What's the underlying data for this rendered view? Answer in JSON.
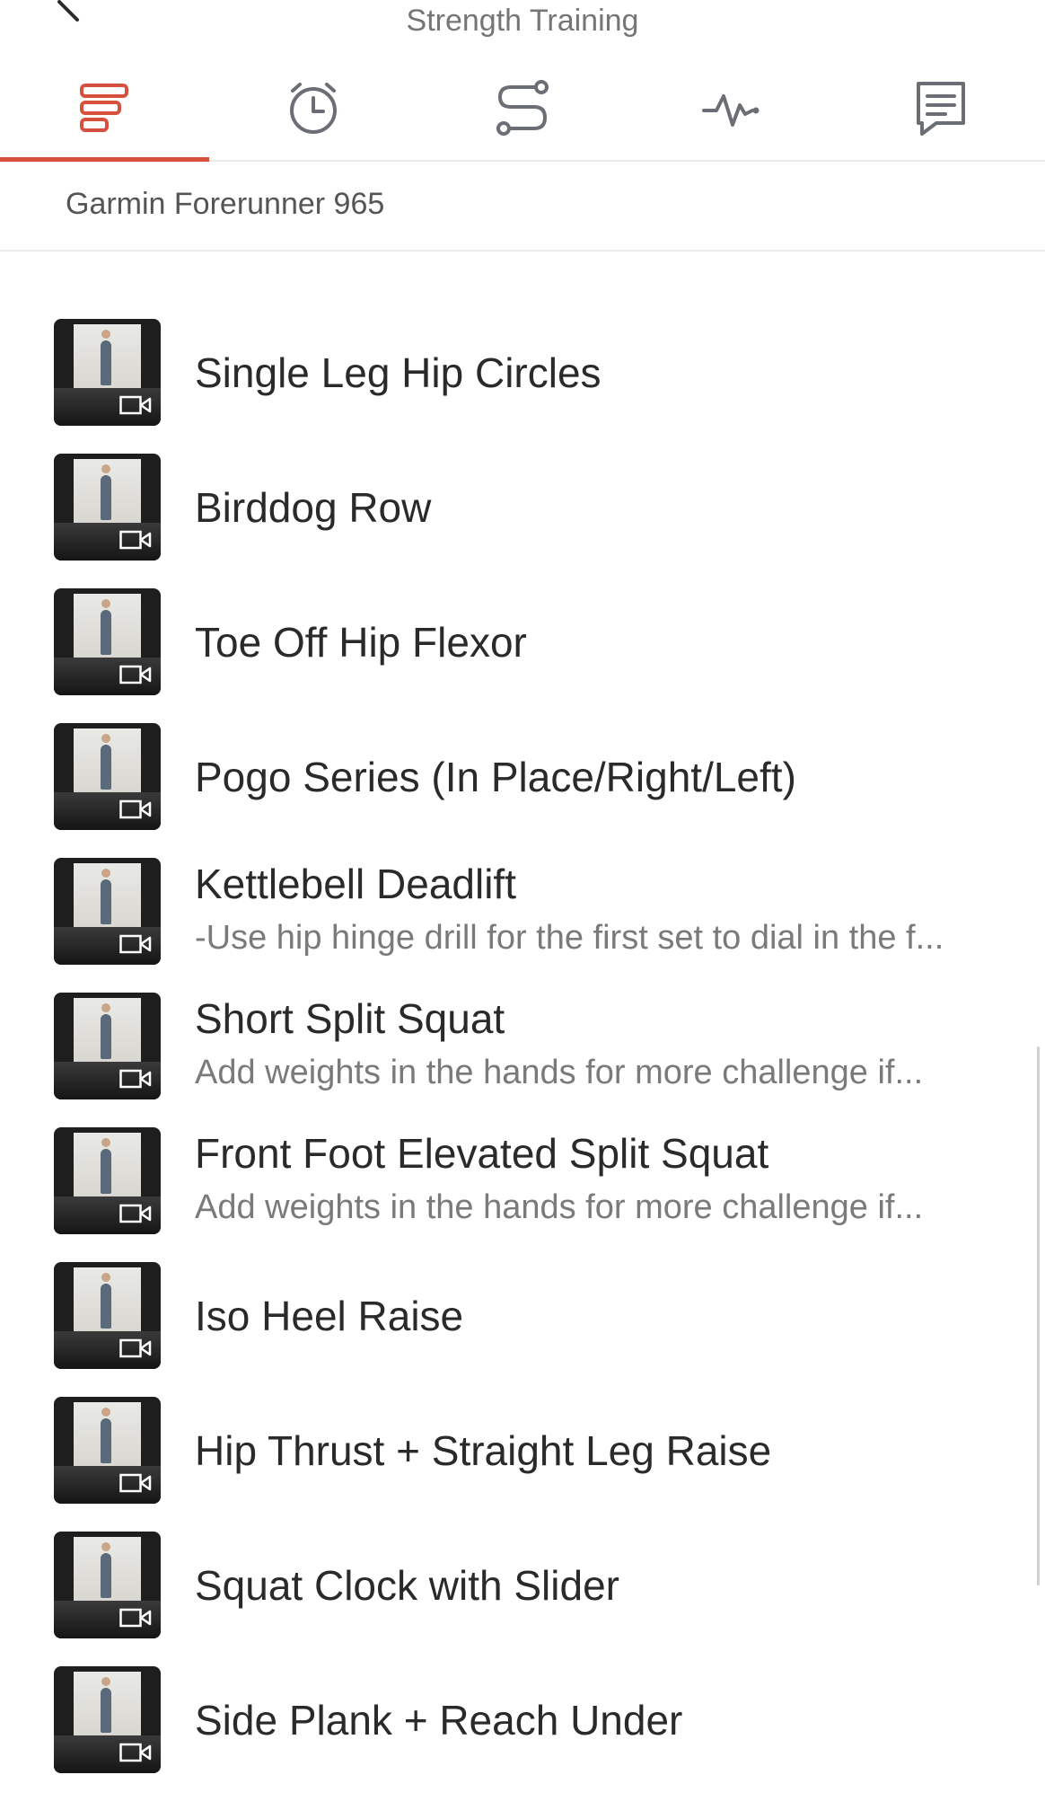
{
  "header": {
    "title": "Strength Training"
  },
  "tabs": [
    {
      "icon": "workout-steps-icon",
      "active": true
    },
    {
      "icon": "timer-icon",
      "active": false
    },
    {
      "icon": "route-icon",
      "active": false
    },
    {
      "icon": "activity-graph-icon",
      "active": false
    },
    {
      "icon": "notes-icon",
      "active": false
    }
  ],
  "device": {
    "label": "Garmin Forerunner 965"
  },
  "colors": {
    "accent": "#d6503d",
    "icon_gray": "#6b6f75"
  },
  "exercises": [
    {
      "name": "Single Leg Hip Circles",
      "note": ""
    },
    {
      "name": "Birddog Row",
      "note": ""
    },
    {
      "name": "Toe Off Hip Flexor",
      "note": ""
    },
    {
      "name": "Pogo Series (In Place/Right/Left)",
      "note": ""
    },
    {
      "name": "Kettlebell Deadlift",
      "note": "-Use hip hinge drill for the first set to dial in the f..."
    },
    {
      "name": "Short Split Squat",
      "note": "Add weights in the hands for more challenge if..."
    },
    {
      "name": "Front Foot Elevated Split Squat",
      "note": "Add weights in the hands for more challenge if..."
    },
    {
      "name": "Iso Heel Raise",
      "note": ""
    },
    {
      "name": "Hip Thrust + Straight Leg Raise",
      "note": ""
    },
    {
      "name": "Squat Clock with Slider",
      "note": ""
    },
    {
      "name": "Side Plank + Reach Under",
      "note": ""
    }
  ]
}
